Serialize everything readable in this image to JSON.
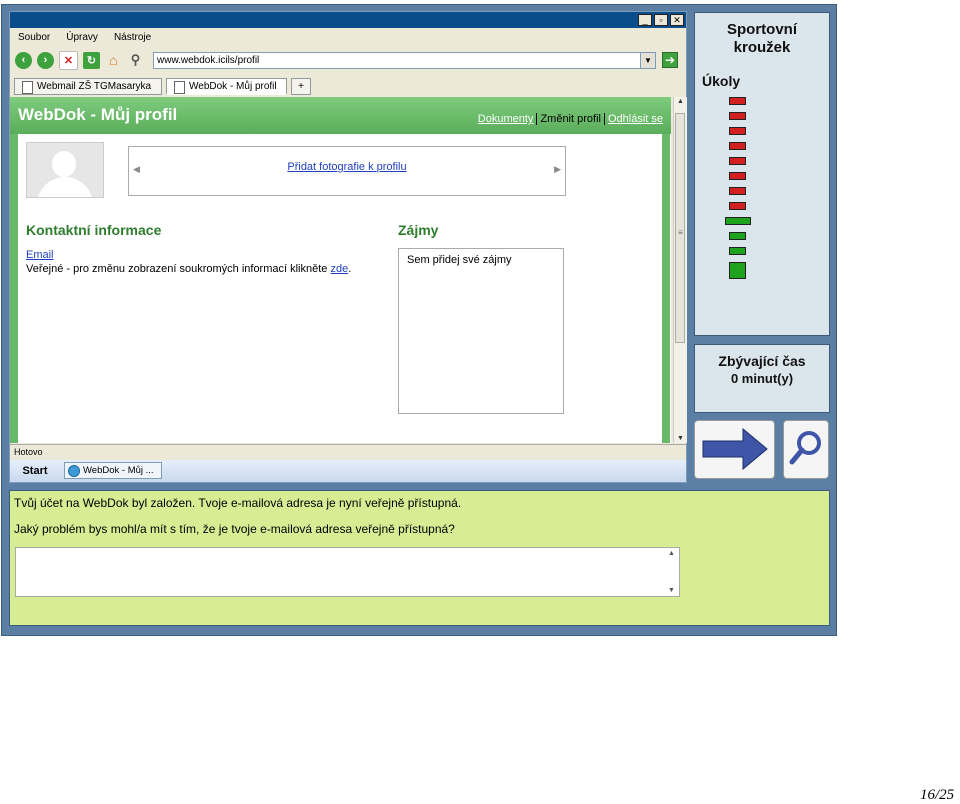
{
  "browser": {
    "menu": [
      "Soubor",
      "Úpravy",
      "Nástroje"
    ],
    "url": "www.webdok.icils/profil",
    "tabs": [
      {
        "label": "Webmail ZŠ TGMasaryka"
      },
      {
        "label": "WebDok - Můj profil"
      },
      {
        "label": "+"
      }
    ],
    "status": "Hotovo",
    "start_label": "Start",
    "taskbar_item": "WebDok - Můj ..."
  },
  "webdok": {
    "title": "WebDok - Můj profil",
    "nav": {
      "documents": "Dokumenty",
      "change_profile": "Změnit profil",
      "logout": "Odhlásit se"
    },
    "add_photo": "Přidat fotografie k profilu",
    "contact_heading": "Kontaktní informace",
    "email_link": "Email",
    "public_text": "Veřejné - pro změnu zobrazení soukromých informací klikněte",
    "here_link": "zde",
    "public_suffix": ".",
    "interests_heading": "Zájmy",
    "interests_text": "Sem přidej své zájmy"
  },
  "sidebar": {
    "title_line1": "Sportovní",
    "title_line2": "kroužek",
    "tasks_label": "Úkoly",
    "tasks": [
      {
        "state": "todo"
      },
      {
        "state": "todo"
      },
      {
        "state": "todo"
      },
      {
        "state": "todo"
      },
      {
        "state": "todo"
      },
      {
        "state": "todo"
      },
      {
        "state": "todo"
      },
      {
        "state": "todo"
      },
      {
        "state": "current"
      },
      {
        "state": "done"
      },
      {
        "state": "done"
      },
      {
        "state": "done-large"
      }
    ],
    "task_colors": {
      "todo": "#d21f1f",
      "current": "#1ea31e",
      "done": "#1ea31e"
    },
    "time_label": "Zbývající čas",
    "time_value": "0 minut(y)"
  },
  "question": {
    "line1": "Tvůj účet na WebDok byl založen. Tvoje e-mailová adresa je nyní veřejně přístupná.",
    "line2": "Jaký problém bys mohl/a mít s tím, že je tvoje e-mailová adresa veřejně přístupná?",
    "answer": ""
  },
  "page_number": "16/25"
}
